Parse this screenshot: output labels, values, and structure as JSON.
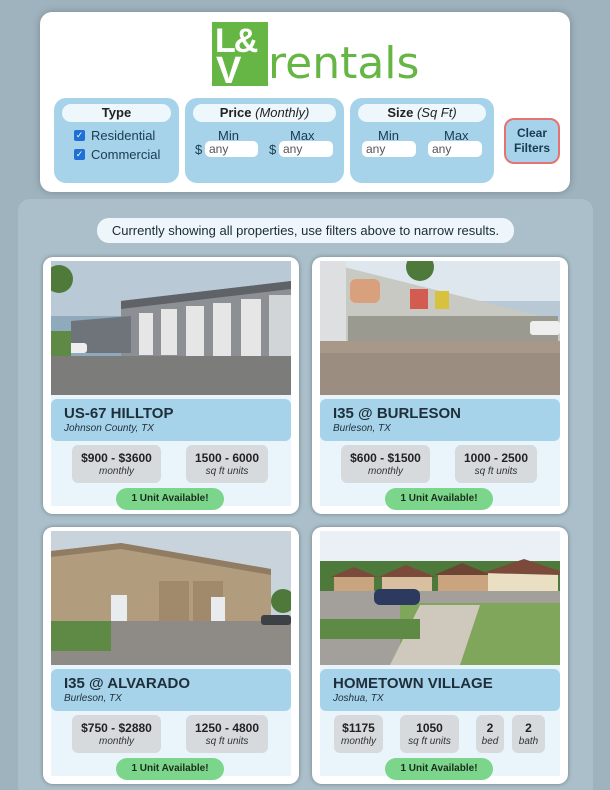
{
  "logo": {
    "mark_top": "L&",
    "mark_bottom": "V",
    "text": "rentals",
    "brand_color": "#65b644"
  },
  "filters": {
    "type": {
      "title": "Type",
      "options": [
        {
          "label": "Residential",
          "checked": true
        },
        {
          "label": "Commercial",
          "checked": true
        }
      ]
    },
    "price": {
      "title": "Price",
      "subtitle": "(Monthly)",
      "min_label": "Min",
      "max_label": "Max",
      "currency": "$",
      "min_placeholder": "any",
      "max_placeholder": "any"
    },
    "size": {
      "title": "Size",
      "subtitle": "(Sq Ft)",
      "min_label": "Min",
      "max_label": "Max",
      "min_placeholder": "any",
      "max_placeholder": "any"
    },
    "clear_label_1": "Clear",
    "clear_label_2": "Filters"
  },
  "notice": "Currently showing all properties, use filters above to narrow results.",
  "properties": [
    {
      "name": "US-67 HILLTOP",
      "location": "Johnson County, TX",
      "price": "$900 - $3600",
      "price_unit": "monthly",
      "size": "1500 - 6000",
      "size_unit": "sq ft units",
      "availability": "1 Unit Available!"
    },
    {
      "name": "I35 @ BURLESON",
      "location": "Burleson, TX",
      "price": "$600 - $1500",
      "price_unit": "monthly",
      "size": "1000 - 2500",
      "size_unit": "sq ft units",
      "availability": "1 Unit Available!"
    },
    {
      "name": "I35 @ ALVARADO",
      "location": "Burleson, TX",
      "price": "$750 - $2880",
      "price_unit": "monthly",
      "size": "1250 - 4800",
      "size_unit": "sq ft units",
      "availability": "1 Unit Available!"
    },
    {
      "name": "HOMETOWN VILLAGE",
      "location": "Joshua, TX",
      "price": "$1175",
      "price_unit": "monthly",
      "size": "1050",
      "size_unit": "sq ft units",
      "beds": "2",
      "beds_unit": "bed",
      "baths": "2",
      "baths_unit": "bath",
      "availability": "1 Unit Available!"
    }
  ]
}
